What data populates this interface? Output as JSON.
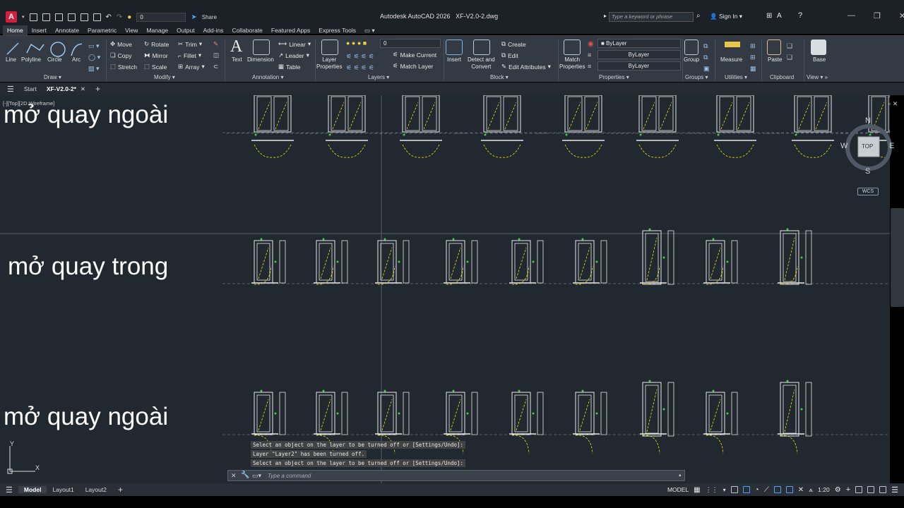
{
  "app": {
    "title": "Autodesk AutoCAD 2026",
    "filename": "XF-V2.0-2.dwg"
  },
  "qat": {
    "layer_value": "0",
    "share_label": "Share"
  },
  "search": {
    "placeholder": "Type a keyword or phrase"
  },
  "user": {
    "signin_label": "Sign In"
  },
  "ribbon_tabs": [
    "Home",
    "Insert",
    "Annotate",
    "Parametric",
    "View",
    "Manage",
    "Output",
    "Add-ins",
    "Collaborate",
    "Featured Apps",
    "Express Tools"
  ],
  "draw": {
    "line": "Line",
    "polyline": "Polyline",
    "circle": "Circle",
    "arc": "Arc",
    "title": "Draw"
  },
  "modify": {
    "move": "Move",
    "rotate": "Rotate",
    "trim": "Trim",
    "copy": "Copy",
    "mirror": "Mirror",
    "fillet": "Fillet",
    "stretch": "Stretch",
    "scale": "Scale",
    "array": "Array",
    "title": "Modify"
  },
  "annotation": {
    "text": "Text",
    "dimension": "Dimension",
    "linear": "Linear",
    "leader": "Leader",
    "table": "Table",
    "title": "Annotation"
  },
  "layers": {
    "layer_properties_1": "Layer",
    "layer_properties_2": "Properties",
    "layer_value": "0",
    "make_current": "Make Current",
    "match_layer": "Match Layer",
    "title": "Layers"
  },
  "block": {
    "insert": "Insert",
    "detect_1": "Detect and",
    "detect_2": "Convert",
    "create": "Create",
    "edit": "Edit",
    "edit_attributes": "Edit Attributes",
    "title": "Block"
  },
  "properties": {
    "match_1": "Match",
    "match_2": "Properties",
    "color": "ByLayer",
    "linetype": "ByLayer",
    "lineweight": "ByLayer",
    "title": "Properties"
  },
  "groups": {
    "group": "Group",
    "title": "Groups"
  },
  "utilities": {
    "measure": "Measure",
    "title": "Utilities"
  },
  "clipboard": {
    "paste": "Paste",
    "title": "Clipboard"
  },
  "view": {
    "base": "Base",
    "title": "View"
  },
  "file_tabs": {
    "start": "Start",
    "active": "XF-V2.0-2*"
  },
  "viewport": {
    "controls": "[-][Top][2D Wireframe]"
  },
  "drawing_labels": [
    "mở quay ngoài",
    "mở quay trong",
    "mở quay ngoài"
  ],
  "viewcube": {
    "top": "TOP",
    "n": "N",
    "s": "S",
    "w": "W",
    "e": "E",
    "wcs": "WCS"
  },
  "ucs": {
    "x": "X",
    "y": "Y"
  },
  "command": {
    "history": [
      "Select an object on the layer to be turned off or [Settings/Undo]:",
      "Layer \"Layer2\" has been turned off.",
      "Select an object on the layer to be turned off or [Settings/Undo]:"
    ],
    "placeholder": "Type a command"
  },
  "layout_tabs": [
    "Model",
    "Layout1",
    "Layout2"
  ],
  "status": {
    "model": "MODEL",
    "scale": "1:20"
  },
  "colors": {
    "canvas": "#212830",
    "ribbon": "#333a44",
    "door_lines": "#e8e8e8",
    "green_markers": "#3ecf3e",
    "yellow_dashed": "#e6e600"
  }
}
